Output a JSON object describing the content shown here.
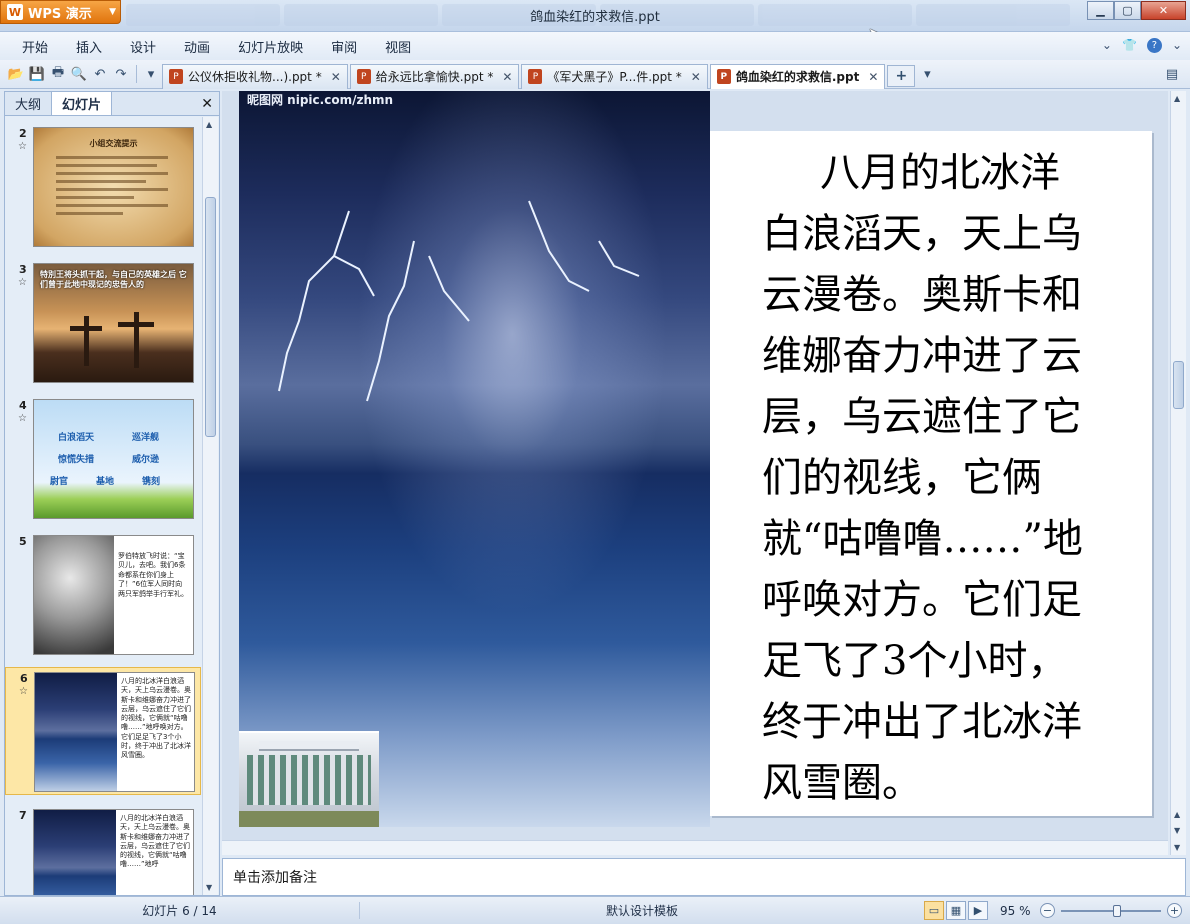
{
  "app": {
    "name": "WPS 演示",
    "window_title": "鸽血染红的求救信.ppt"
  },
  "menu": [
    "开始",
    "插入",
    "设计",
    "动画",
    "幻灯片放映",
    "审阅",
    "视图"
  ],
  "doc_tabs": [
    {
      "label": "公仪休拒收礼物...).ppt *",
      "active": false
    },
    {
      "label": "给永远比拿愉快.ppt *",
      "active": false
    },
    {
      "label": "《军犬黑子》P...件.ppt *",
      "active": false
    },
    {
      "label": "鸽血染红的求救信.ppt",
      "active": true
    }
  ],
  "panel": {
    "tab_outline": "大纲",
    "tab_slides": "幻灯片"
  },
  "thumbnails": [
    {
      "num": "2",
      "title": "小组交流提示"
    },
    {
      "num": "3",
      "title": "特別王将头抓干起，与自己的英雄之后 它们曾于此地中现记的忠告人的"
    },
    {
      "num": "4",
      "words": [
        "白浪滔天",
        "巡洋舰",
        "惊慌失措",
        "威尔逊",
        "尉官",
        "基地",
        "镌刻"
      ]
    },
    {
      "num": "5",
      "text": "罗伯特放飞时说：“宝贝儿，去吧。我们6条命都系在你们身上了！”6位军人同时向两只军鸽举手行军礼。"
    },
    {
      "num": "6",
      "text": "八月的北冰洋白浪滔天，天上乌云漫卷。奥斯卡和维娜奋力冲进了云层，乌云遮住了它们的视线，它俩就“咕噜噜……”地呼唤对方。它们足足飞了3个小时，终于冲出了北冰洋风雪圈。"
    },
    {
      "num": "7",
      "text": "八月的北冰洋白浪滔天，天上乌云漫卷。奥斯卡和维娜奋力冲进了云层，乌云遮住了它们的视线，它俩就“咕噜噜……”地呼"
    }
  ],
  "slide": {
    "watermark": "昵图网 nipic.com/zhmn",
    "text": "八月的北冰洋白浪滔天，天上乌云漫卷。奥斯卡和维娜奋力冲进了云层，乌云遮住了它们的视线，它俩就“咕噜噜……”地呼唤对方。它们足足飞了3个小时，终于冲出了北冰洋风雪圈。"
  },
  "notes_placeholder": "单击添加备注",
  "status": {
    "slide_counter": "幻灯片 6 / 14",
    "design_template": "默认设计模板",
    "zoom": "95 %"
  }
}
